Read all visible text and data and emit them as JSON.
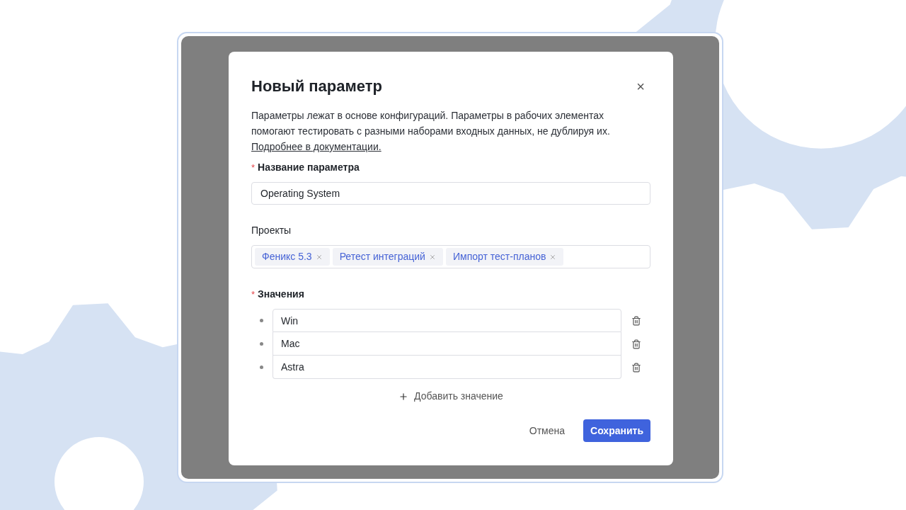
{
  "dialog": {
    "title": "Новый параметр",
    "close": "×",
    "required_mark": "*",
    "description": "Параметры лежат в основе конфигураций. Параметры в рабочих элементах помогают тестировать с разными наборами входных данных, не дублируя их.",
    "doc_link": "Подробнее в документации.",
    "name_field": {
      "label": "Название параметра",
      "required": true,
      "value": "Operating System"
    },
    "projects": {
      "label": "Проекты",
      "required": false,
      "tags": [
        {
          "label": "Феникс 5.3"
        },
        {
          "label": "Ретест интеграций"
        },
        {
          "label": "Импорт тест-планов"
        }
      ]
    },
    "values_field": {
      "label": "Значения",
      "required": true,
      "items": [
        {
          "value": "Win"
        },
        {
          "value": "Mac"
        },
        {
          "value": "Astra"
        }
      ]
    },
    "add_button": "Добавить значение",
    "cancel_button": "Отмена",
    "save_button": "Сохранить"
  }
}
